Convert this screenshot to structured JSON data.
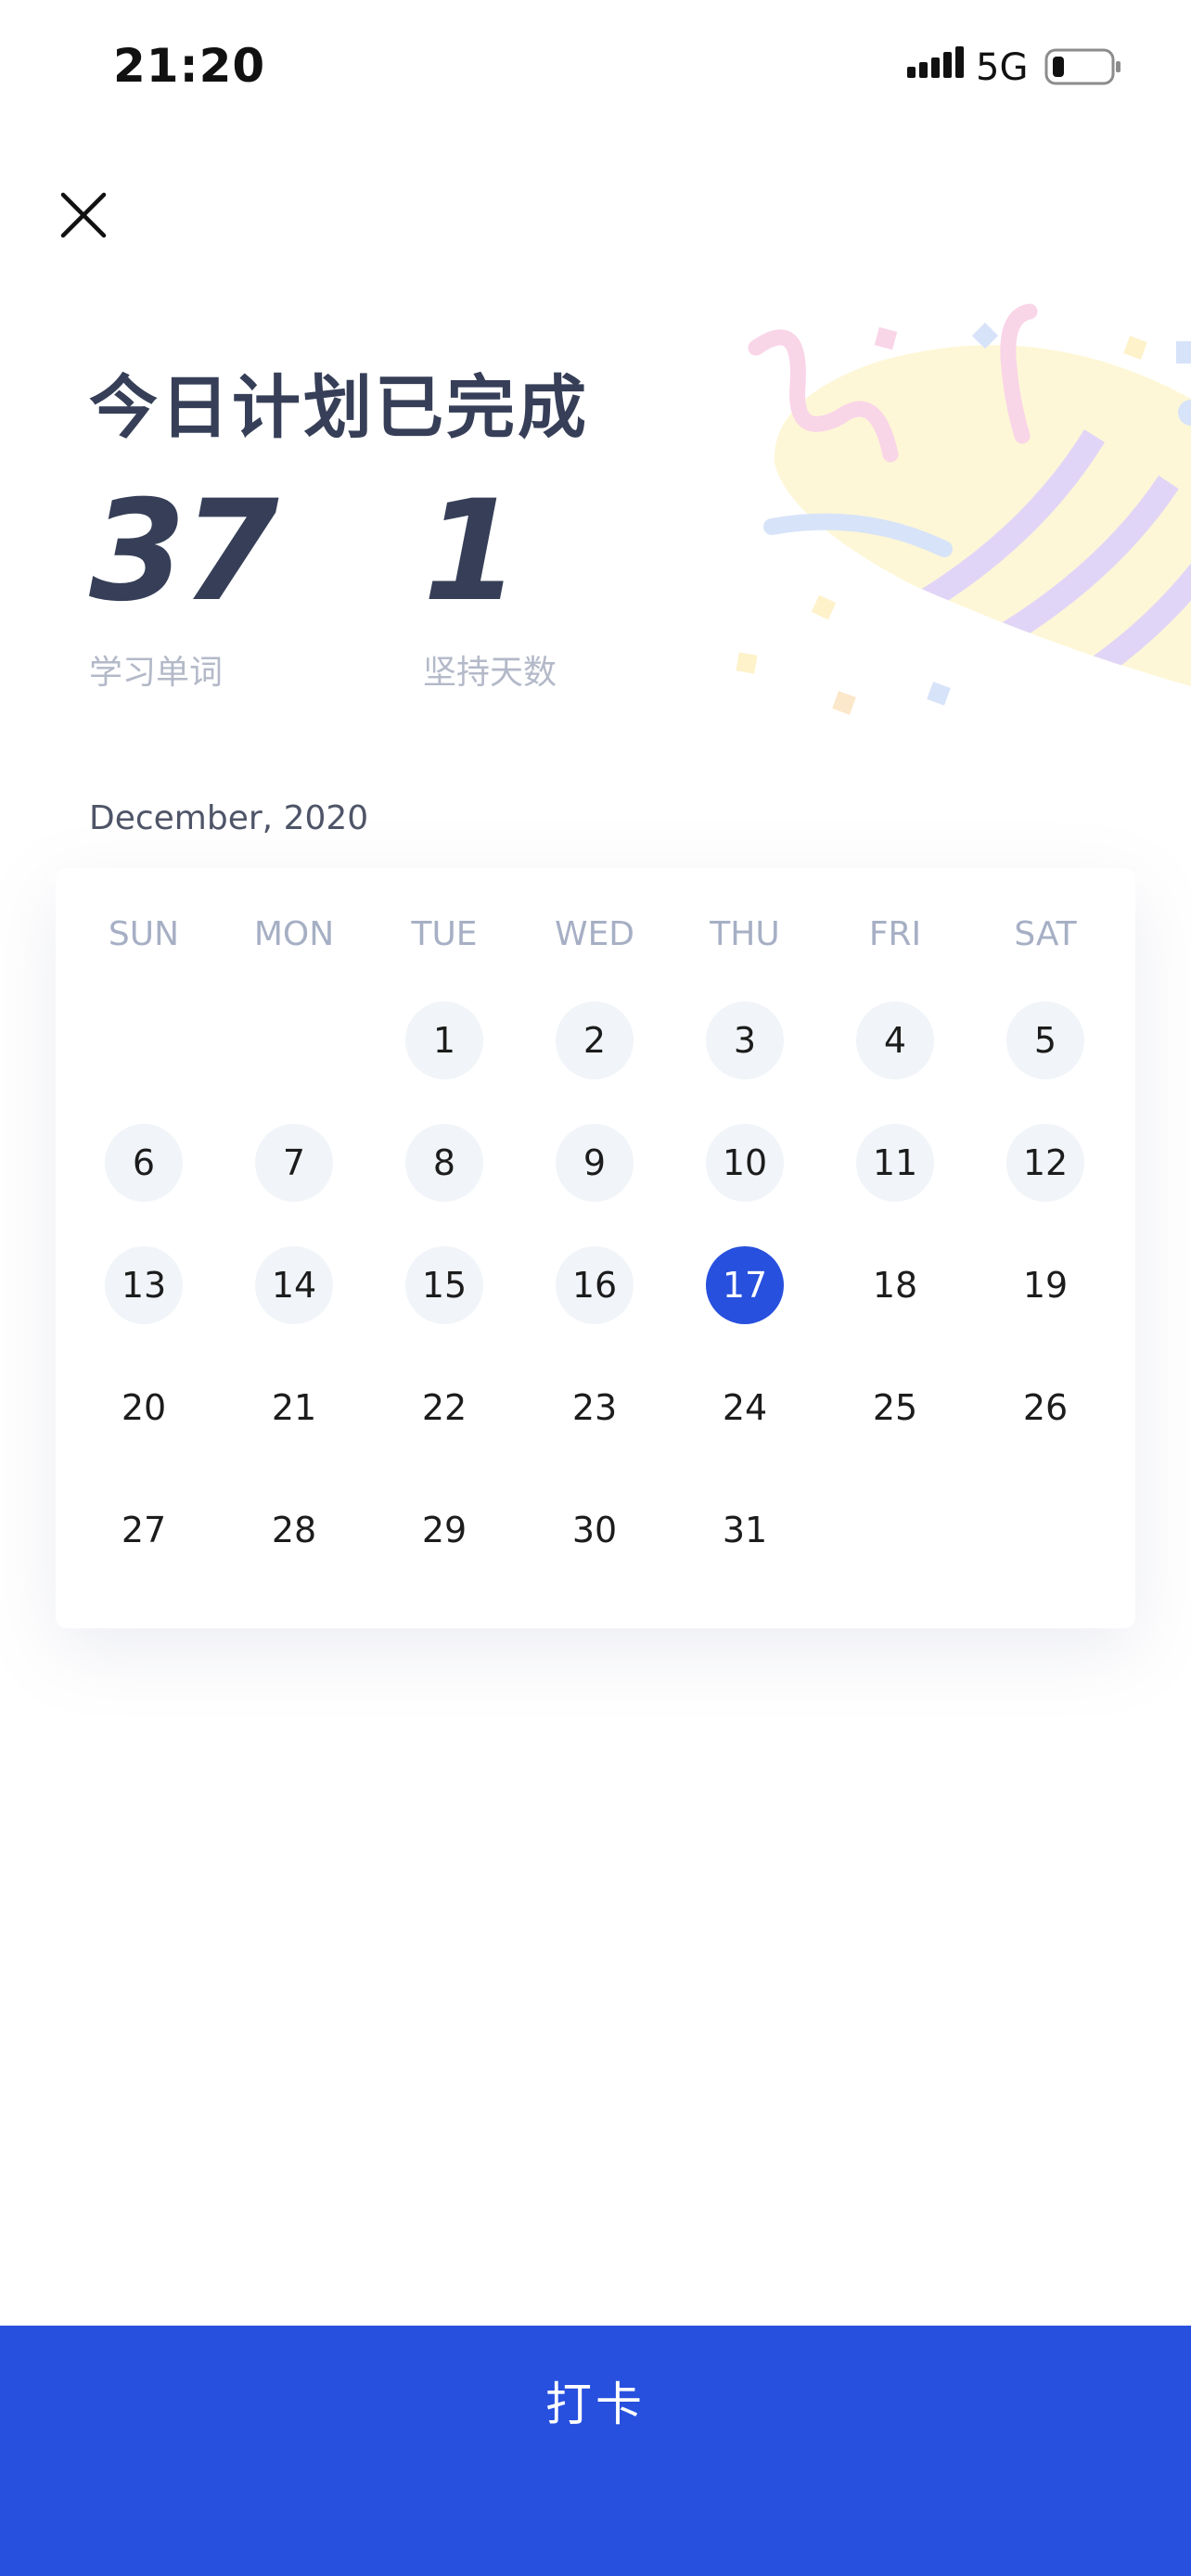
{
  "status_bar": {
    "time": "21:20",
    "network": "5G",
    "icons": [
      "signal-icon",
      "battery-icon"
    ]
  },
  "header": {
    "close_icon": "close-icon"
  },
  "summary": {
    "title": "今日计划已完成",
    "stats": [
      {
        "value": "37",
        "label": "学习单词"
      },
      {
        "value": "1",
        "label": "坚持天数"
      }
    ]
  },
  "calendar": {
    "month_label": "December, 2020",
    "weekdays": [
      "SUN",
      "MON",
      "TUE",
      "WED",
      "THU",
      "FRI",
      "SAT"
    ],
    "first_weekday_index": 2,
    "days_in_month": 31,
    "completed_days": [
      1,
      2,
      3,
      4,
      5,
      6,
      7,
      8,
      9,
      10,
      11,
      12,
      13,
      14,
      15,
      16
    ],
    "today": 17
  },
  "action": {
    "checkin_label": "打卡"
  },
  "colors": {
    "accent": "#2750de",
    "title_text": "#363f57",
    "muted_text": "#b3b9c8",
    "weekday_text": "#a6afc4",
    "completed_day_bg": "#f1f4f8"
  }
}
